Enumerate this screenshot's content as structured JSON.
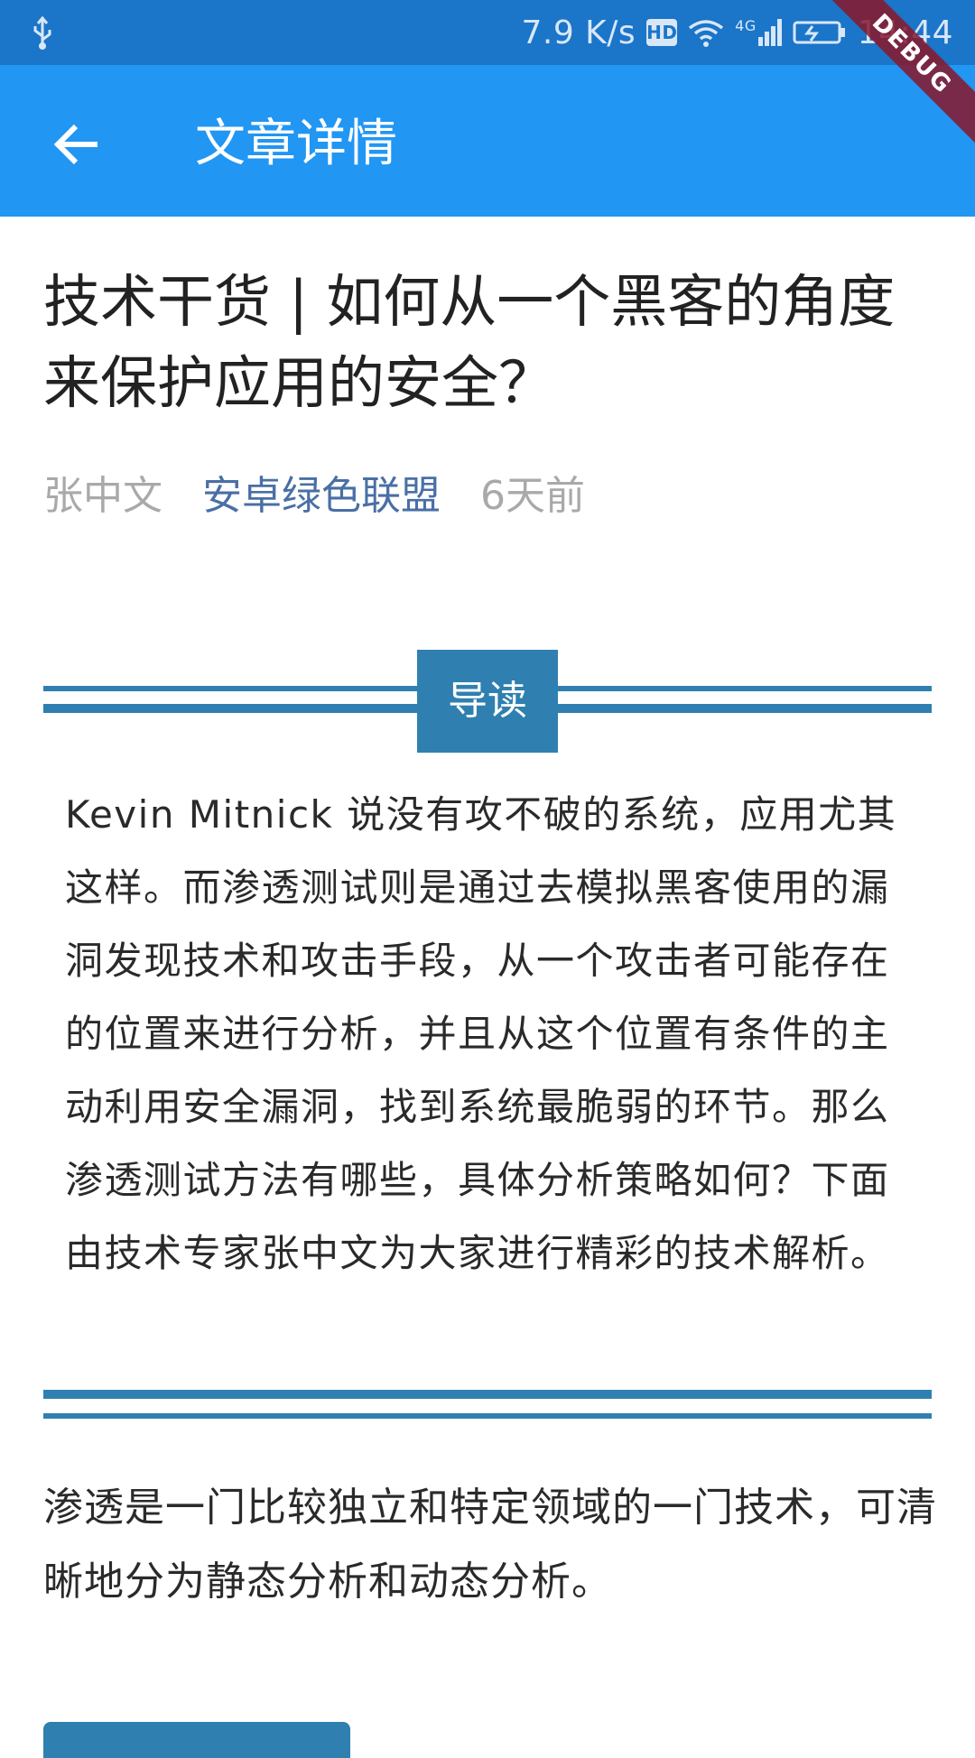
{
  "status_bar": {
    "speed": "7.9 K/s",
    "hd": "HD",
    "network": "4G",
    "time": "14:44"
  },
  "app_bar": {
    "title": "文章详情"
  },
  "debug_banner": "DEBUG",
  "article": {
    "title": "技术干货 | 如何从一个黑客的角度来保护应用的安全？",
    "author": "张中文",
    "source": "安卓绿色联盟",
    "time": "6天前",
    "intro_label": "导读",
    "intro_text": "Kevin Mitnick 说没有攻不破的系统，应用尤其这样。而渗透测试则是通过去模拟黑客使用的漏洞发现技术和攻击手段，从一个攻击者可能存在的位置来进行分析，并且从这个位置有条件的主动利用安全漏洞，找到系统最脆弱的环节。那么渗透测试方法有哪些，具体分析策略如何？下面由技术专家张中文为大家进行精彩的技术解析。",
    "paragraph": "渗透是一门比较独立和特定领域的一门技术，可清晰地分为静态分析和动态分析。"
  },
  "colors": {
    "status_bar": "#1b75c9",
    "app_bar": "#2196f3",
    "accent_rule": "#2f80b0",
    "source_link": "#4a6fa5"
  }
}
